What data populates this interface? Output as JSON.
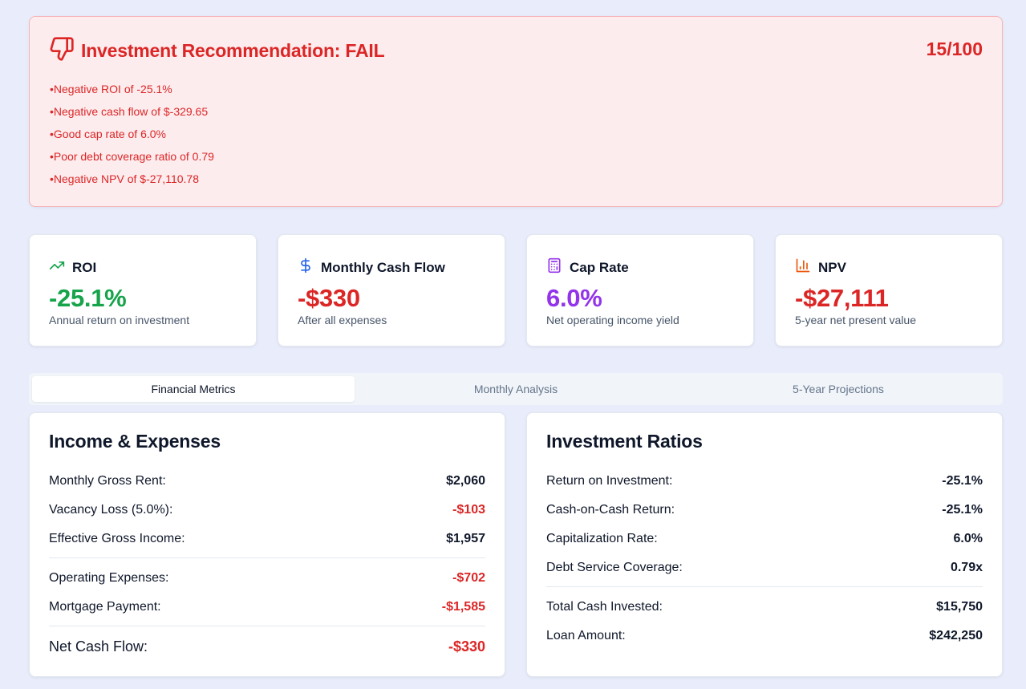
{
  "recommendation": {
    "title": "Investment Recommendation: FAIL",
    "score": "15/100",
    "reasons": [
      "Negative ROI of -25.1%",
      "Negative cash flow of $-329.65",
      "Good cap rate of 6.0%",
      "Poor debt coverage ratio of 0.79",
      "Negative NPV of $-27,110.78"
    ]
  },
  "metrics": [
    {
      "label": "ROI",
      "value": "-25.1%",
      "sub": "Annual return on investment",
      "icon": "trending-up-icon"
    },
    {
      "label": "Monthly Cash Flow",
      "value": "-$330",
      "sub": "After all expenses",
      "icon": "dollar-icon"
    },
    {
      "label": "Cap Rate",
      "value": "6.0%",
      "sub": "Net operating income yield",
      "icon": "calculator-icon"
    },
    {
      "label": "NPV",
      "value": "-$27,111",
      "sub": "5-year net present value",
      "icon": "bar-chart-icon"
    }
  ],
  "tabs": [
    "Financial Metrics",
    "Monthly Analysis",
    "5-Year Projections"
  ],
  "income": {
    "title": "Income & Expenses",
    "rows": [
      {
        "k": "Monthly Gross Rent:",
        "v": "$2,060"
      },
      {
        "k": "Vacancy Loss (5.0%):",
        "v": "-$103"
      },
      {
        "k": "Effective Gross Income:",
        "v": "$1,957"
      },
      {
        "k": "Operating Expenses:",
        "v": "-$702"
      },
      {
        "k": "Mortgage Payment:",
        "v": "-$1,585"
      },
      {
        "k": "Net Cash Flow:",
        "v": "-$330"
      }
    ]
  },
  "ratios": {
    "title": "Investment Ratios",
    "rows": [
      {
        "k": "Return on Investment:",
        "v": "-25.1%"
      },
      {
        "k": "Cash-on-Cash Return:",
        "v": "-25.1%"
      },
      {
        "k": "Capitalization Rate:",
        "v": "6.0%"
      },
      {
        "k": "Debt Service Coverage:",
        "v": "0.79x"
      },
      {
        "k": "Total Cash Invested:",
        "v": "$15,750"
      },
      {
        "k": "Loan Amount:",
        "v": "$242,250"
      }
    ]
  },
  "colors": {
    "fail": "#dc2626",
    "positive": "#16a34a",
    "cap_rate": "#9333ea",
    "dollar_icon": "#2563eb",
    "npv_icon": "#ea580c"
  }
}
